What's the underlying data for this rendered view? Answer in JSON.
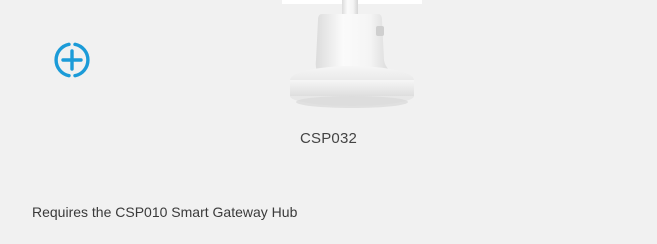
{
  "product": {
    "name": "CSP032",
    "requirement": "Requires the CSP010 Smart Gateway Hub"
  },
  "icons": {
    "add": "add-circle-icon"
  },
  "colors": {
    "accent": "#1b9bd8",
    "background": "#f1f1f1"
  }
}
